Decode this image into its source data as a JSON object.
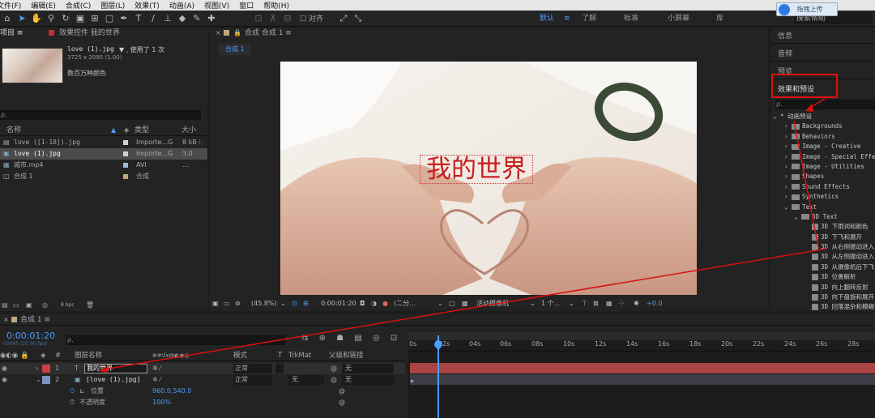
{
  "menu": [
    "文件(F)",
    "编辑(E)",
    "合成(C)",
    "图层(L)",
    "效果(T)",
    "动画(A)",
    "视图(V)",
    "窗口",
    "帮助(H)"
  ],
  "toolbar": {
    "align_label": "对齐",
    "workspaces": [
      "默认",
      "≡",
      "了解",
      "标准",
      "小屏幕",
      "库"
    ],
    "search_placeholder": "搜索帮助",
    "upload_popup": "拖拽上传"
  },
  "project": {
    "tab_label": "项目 ≡",
    "effects_tab_label": "效果控件 我的世界",
    "preview_name": "love (1).jpg",
    "preview_used": "▼ , 使用了 1 次",
    "preview_dims": "3725 x 2095 (1.00)",
    "preview_colors": "数百万种颜色",
    "search_placeholder": "ρ.",
    "col_name": "名称",
    "col_type": "类型",
    "col_size": "大小",
    "items": [
      {
        "name": "love ([1-18]).jpg",
        "type": "Importe...G",
        "size": "8 kB",
        "color": "#d0d0d0"
      },
      {
        "name": "love (1).jpg",
        "type": "Importe...G",
        "size": "3.0",
        "color": "#d0d0d0",
        "selected": true
      },
      {
        "name": "城市.mp4",
        "type": "AVI",
        "size": "...",
        "color": "#a0b8d0"
      },
      {
        "name": "合成 1",
        "type": "合成",
        "size": "",
        "color": "#c0a880"
      }
    ],
    "bpc": "8 bpc"
  },
  "composition": {
    "tab_label": "合成 合成 1 ≡",
    "sub_tab": "合成 1",
    "title_text": "我的世界",
    "zoom": "(45.8%)",
    "timecode": "0:00:01:20",
    "resolution": "(二分...",
    "camera": "活动摄像机",
    "views": "1 个...",
    "exposure": "+0.0"
  },
  "right_panel": {
    "info": "信息",
    "audio": "音频",
    "preview": "预览",
    "effects_presets": "效果和预设",
    "search_placeholder": "ρ.",
    "tree": [
      {
        "label": "* 动画预设",
        "level": 0,
        "kind": "root"
      },
      {
        "label": "Backgrounds",
        "level": 1,
        "kind": "folder"
      },
      {
        "label": "Behaviors",
        "level": 1,
        "kind": "folder"
      },
      {
        "label": "Image - Creative",
        "level": 1,
        "kind": "folder"
      },
      {
        "label": "Image - Special Effects",
        "level": 1,
        "kind": "folder"
      },
      {
        "label": "Image - Utilities",
        "level": 1,
        "kind": "folder"
      },
      {
        "label": "Shapes",
        "level": 1,
        "kind": "folder"
      },
      {
        "label": "Sound Effects",
        "level": 1,
        "kind": "folder"
      },
      {
        "label": "Synthetics",
        "level": 1,
        "kind": "folder"
      },
      {
        "label": "Text",
        "level": 1,
        "kind": "folder-open"
      },
      {
        "label": "3D Text",
        "level": 2,
        "kind": "folder-open"
      },
      {
        "label": "3D 下雨词和颜色",
        "level": 3,
        "kind": "preset"
      },
      {
        "label": "3D 下飞和展开",
        "level": 3,
        "kind": "preset"
      },
      {
        "label": "3D 从右侧振动进入",
        "level": 3,
        "kind": "preset"
      },
      {
        "label": "3D 从左侧振动进入",
        "level": 3,
        "kind": "preset"
      },
      {
        "label": "3D 从摄像机后下飞",
        "level": 3,
        "kind": "preset"
      },
      {
        "label": "3D 位置解析",
        "level": 3,
        "kind": "preset"
      },
      {
        "label": "3D 向上翻转反射",
        "level": 3,
        "kind": "preset"
      },
      {
        "label": "3D 向下盘旋和展开",
        "level": 3,
        "kind": "preset"
      },
      {
        "label": "3D 回落混杂和模糊",
        "level": 3,
        "kind": "preset"
      }
    ]
  },
  "timeline": {
    "tab_label": "合成 1 ≡",
    "timecode": "0:00:01:20",
    "frame_info": "00045 (25.00 fps)",
    "search_placeholder": "ρ.",
    "col_layer_name": "图层名称",
    "col_mode": "模式",
    "col_t": "T",
    "col_trkmat": "TrkMat",
    "col_parent": "父级和链接",
    "ruler": [
      "0s",
      "02s",
      "04s",
      "06s",
      "08s",
      "10s",
      "12s",
      "14s",
      "16s",
      "18s",
      "20s",
      "22s",
      "24s",
      "26s",
      "28s"
    ],
    "layers": [
      {
        "num": "1",
        "type": "T",
        "name": "我的世界",
        "mode": "正常",
        "trkmat": "",
        "parent": "无",
        "color": "#c84040"
      },
      {
        "num": "2",
        "type": "▣",
        "name": "[love (1).jpg]",
        "mode": "正常",
        "trkmat": "无",
        "parent": "无",
        "color": "#8090c0"
      }
    ],
    "props": [
      {
        "label": "位置",
        "value": "960.0,540.0"
      },
      {
        "label": "不透明度",
        "value": "100%"
      }
    ]
  }
}
